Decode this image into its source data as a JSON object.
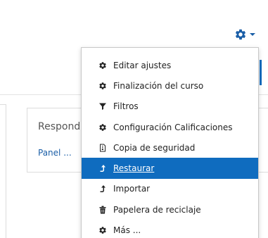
{
  "card": {
    "title": "Respond",
    "link": "Panel ..."
  },
  "settings_menu": {
    "toggle_icon": "gear-icon",
    "accent_color": "#0f6cbf",
    "items": [
      {
        "label": "Editar ajustes",
        "icon": "gear-icon"
      },
      {
        "label": "Finalización del curso",
        "icon": "gear-icon"
      },
      {
        "label": "Filtros",
        "icon": "filter-icon"
      },
      {
        "label": "Configuración Calificaciones",
        "icon": "gear-icon"
      },
      {
        "label": "Copia de seguridad",
        "icon": "file-archive-icon"
      },
      {
        "label": "Restaurar",
        "icon": "level-up-icon",
        "active": true
      },
      {
        "label": "Importar",
        "icon": "level-up-icon"
      },
      {
        "label": "Papelera de reciclaje",
        "icon": "trash-icon"
      },
      {
        "label": "Más ...",
        "icon": "gear-icon"
      }
    ]
  }
}
